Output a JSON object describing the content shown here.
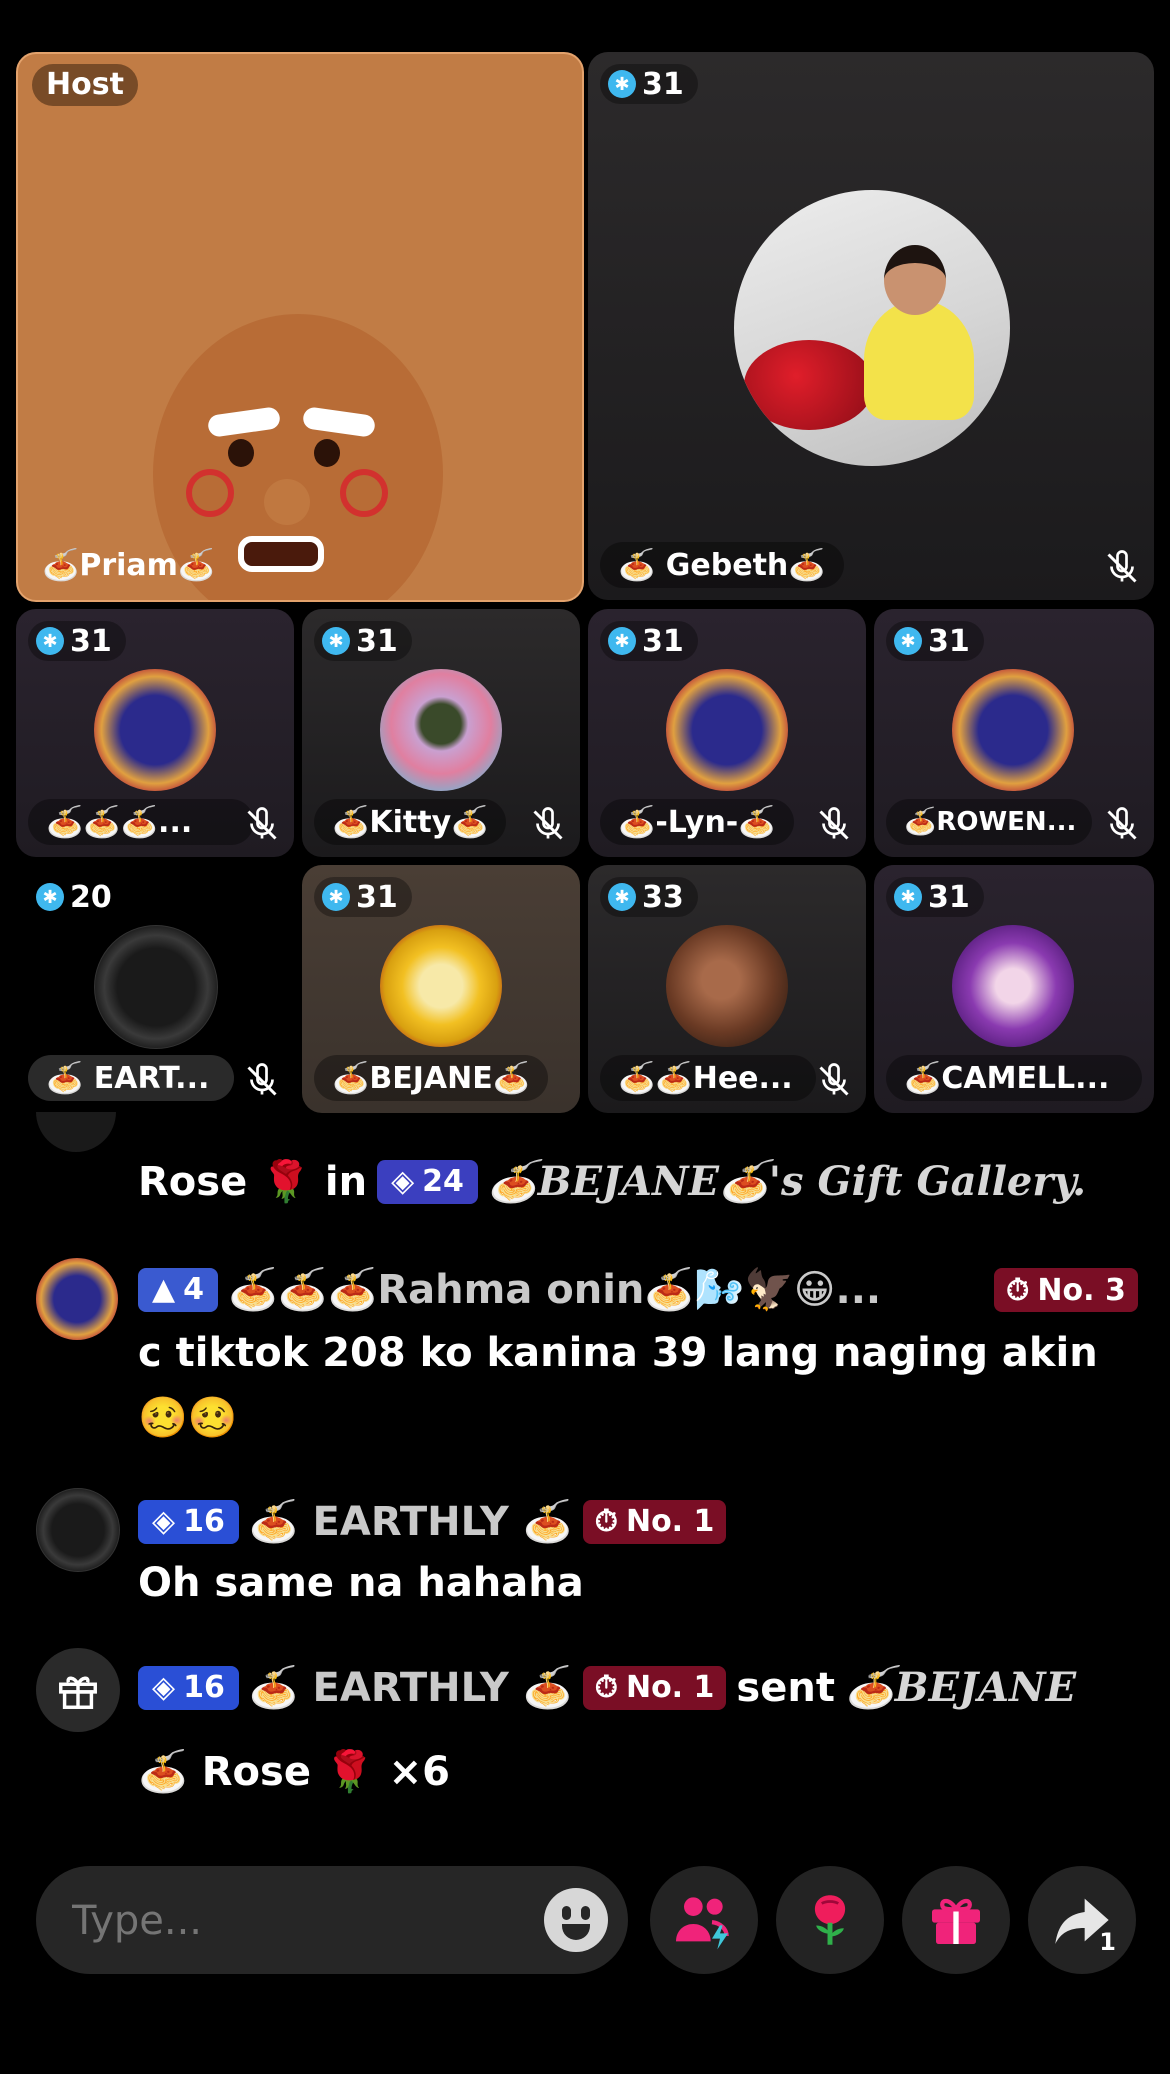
{
  "host_tile": {
    "badge": "Host",
    "name": "🍝Priam🍝"
  },
  "gebeth_tile": {
    "level": "31",
    "name": "🍝 Gebeth🍝"
  },
  "grid_row1": [
    {
      "level": "31",
      "name": "🍝🍝🍝..."
    },
    {
      "level": "31",
      "name": "🍝Kitty🍝"
    },
    {
      "level": "31",
      "name": "🍝-Lyn-🍝"
    },
    {
      "level": "31",
      "name": "🍝ROWEN..."
    }
  ],
  "grid_row2": [
    {
      "level": "20",
      "name": "🍝 EART..."
    },
    {
      "level": "31",
      "name": "🍝BEJANE🍝"
    },
    {
      "level": "33",
      "name": "🍝🍝Hee..."
    },
    {
      "level": "31",
      "name": "🍝CAMELL..."
    }
  ],
  "chat": {
    "msg0": {
      "pre": "Rose 🌹 in",
      "level": "24",
      "post": "🍝BEJANE🍝's Gift Gallery."
    },
    "msg1": {
      "level": "4",
      "name": "🍝🍝🍝Rahma onin🍝🌬️🦅😀...",
      "rank": "No. 3",
      "text1": "c tiktok 208 ko kanina 39 lang naging akin",
      "text2": "🥴🥴"
    },
    "msg2": {
      "level": "16",
      "name": "🍝 EARTHLY 🍝",
      "rank": "No. 1",
      "text": "Oh same na hahaha"
    },
    "msg3": {
      "level": "16",
      "name": "🍝 EARTHLY 🍝",
      "rank": "No. 1",
      "sent": "sent",
      "target": "🍝BEJANE",
      "gift": "🍝 Rose 🌹 ×6"
    }
  },
  "input": {
    "placeholder": "Type..."
  },
  "share_count": "1",
  "colors": {
    "accent_blue": "#2a4fd6",
    "rank_red": "#7a0e25",
    "host_bg": "#c17c45"
  }
}
